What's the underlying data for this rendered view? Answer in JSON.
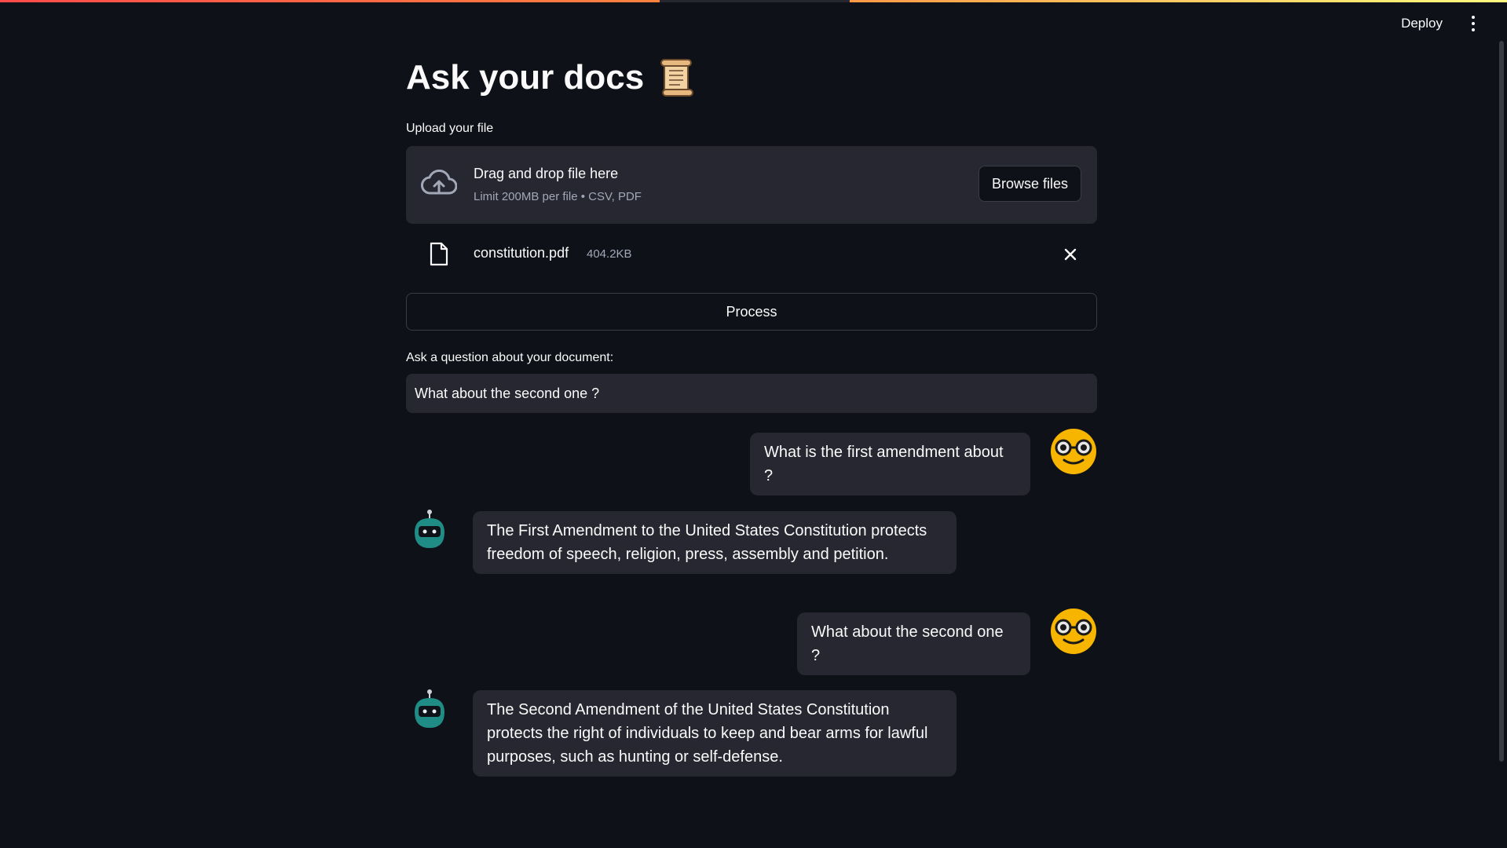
{
  "header": {
    "deploy_label": "Deploy",
    "menu_icon": "more-vertical-icon"
  },
  "title": {
    "text": "Ask your docs",
    "emoji_icon": "scroll-icon"
  },
  "uploader": {
    "label": "Upload your file",
    "drop_title": "Drag and drop file here",
    "drop_subtitle": "Limit 200MB per file • CSV, PDF",
    "browse_label": "Browse files",
    "icon": "cloud-upload-icon"
  },
  "uploaded_file": {
    "name": "constitution.pdf",
    "size": "404.2KB",
    "icon": "file-icon",
    "remove_icon": "close-icon"
  },
  "process_button": {
    "label": "Process"
  },
  "question": {
    "label": "Ask a question about your document:",
    "value": "What about the second one ?"
  },
  "chat": {
    "messages": [
      {
        "role": "user",
        "text": "What is the first amendment about ?",
        "avatar": "nerd-face-icon"
      },
      {
        "role": "bot",
        "text": "The First Amendment to the United States Constitution protects freedom of speech, religion, press, assembly and petition.",
        "avatar": "robot-icon"
      },
      {
        "role": "user",
        "text": "What about the second one ?",
        "avatar": "nerd-face-icon"
      },
      {
        "role": "bot",
        "text": "The Second Amendment of the United States Constitution protects the right of individuals to keep and bear arms for lawful purposes, such as hunting or self-defense.",
        "avatar": "robot-icon"
      }
    ]
  },
  "colors": {
    "background": "#0e1117",
    "surface": "#262730",
    "text": "#fafafa",
    "muted_text": "#a3a8b8",
    "user_avatar": "#f7b500",
    "bot_avatar": "#1f8c86"
  }
}
